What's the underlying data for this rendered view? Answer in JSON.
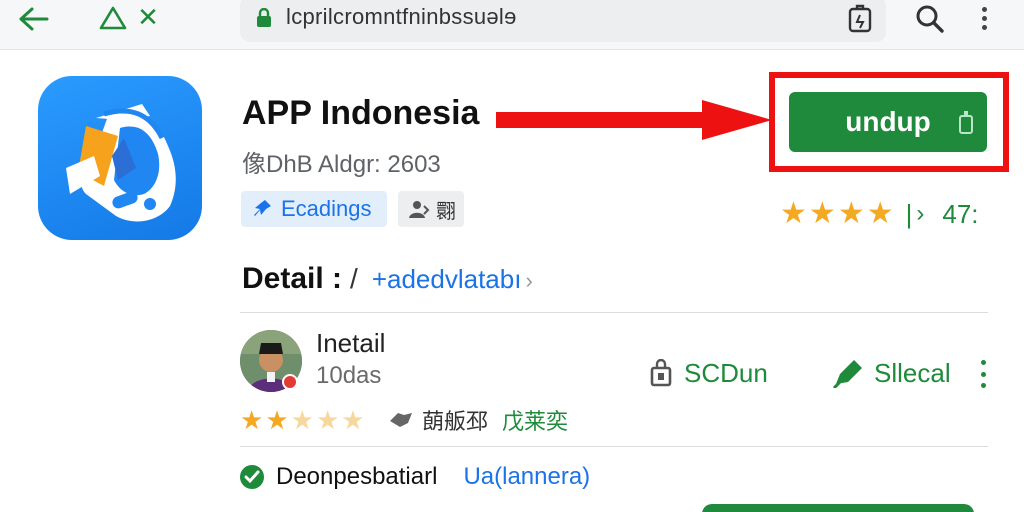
{
  "browser": {
    "url": "lcprilcromntfninbssuəlɘ",
    "icons": [
      "back-arrow-icon",
      "triangle-icon",
      "close-icon",
      "lock-icon",
      "extension-icon",
      "search-icon",
      "menu-icon"
    ]
  },
  "app": {
    "title": "APP Indonesia",
    "subtitle": "像DhB Aldgr: 2603",
    "chips": [
      {
        "label": "Ecadings",
        "icon": "pin-icon"
      },
      {
        "label": "翾",
        "icon": "person-icon"
      }
    ],
    "install_button": {
      "label": "undup",
      "icon": "device-icon"
    },
    "rating": {
      "stars": 4,
      "max_stars": 4,
      "separator": "|",
      "chevron": "›",
      "value": "47:"
    }
  },
  "detail": {
    "title": "Detail :",
    "slash": "/",
    "link": "+adedvlatabı",
    "chevron": "›"
  },
  "review": {
    "name": "Inetail",
    "time": "10das",
    "share_label": "SCDun",
    "flag_label": "Sllecal",
    "stars_full": 2,
    "stars_total": 5,
    "helpful_text": "蓢舨邳",
    "helpful_accent": "戊莱奕"
  },
  "verified": {
    "label": "Deonpesbatiarl",
    "link": "Ua(lannera)"
  },
  "colors": {
    "accent_green": "#1f8a3b",
    "highlight_red": "#ee1111",
    "link_blue": "#1a73e8",
    "star": "#f4a923"
  }
}
